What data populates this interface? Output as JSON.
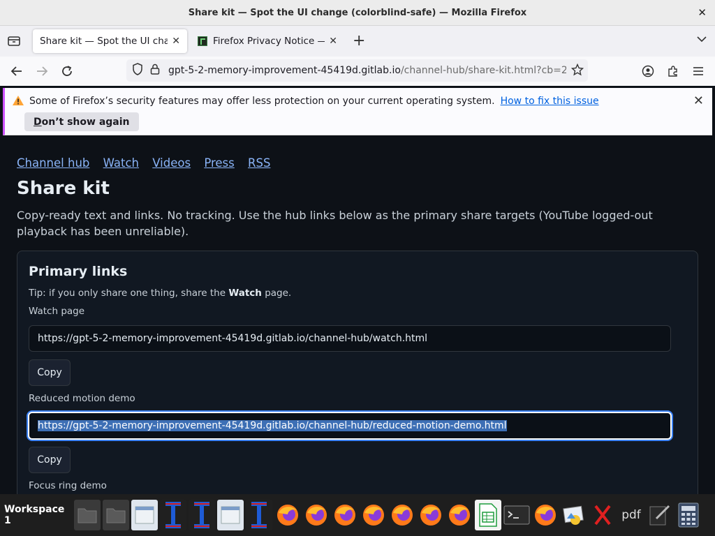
{
  "window": {
    "title": "Share kit — Spot the UI change (colorblind-safe) — Mozilla Firefox"
  },
  "tabs": [
    {
      "label": "Share kit — Spot the UI change"
    },
    {
      "label": "Firefox Privacy Notice — "
    }
  ],
  "urlbar": {
    "host": "gpt-5-2-memory-improvement-45419d.gitlab.io",
    "path": "/channel-hub/share-kit.html?cb=2"
  },
  "notice": {
    "message": "Some of Firefox’s security features may offer less protection on your current operating system.",
    "link": "How to fix this issue",
    "dismiss_first": "D",
    "dismiss_rest": "on’t show again"
  },
  "page": {
    "breadcrumbs": [
      "Channel hub",
      "Watch",
      "Videos",
      "Press",
      "RSS"
    ],
    "title": "Share kit",
    "intro": "Copy-ready text and links. No tracking. Use the hub links below as the primary share targets (YouTube logged-out playback has been unreliable).",
    "card": {
      "title": "Primary links",
      "tip_before": "Tip: if you only share one thing, share the ",
      "tip_bold": "Watch",
      "tip_after": " page.",
      "fields": [
        {
          "label": "Watch page",
          "value": "https://gpt-5-2-memory-improvement-45419d.gitlab.io/channel-hub/watch.html",
          "button": "Copy"
        },
        {
          "label": "Reduced motion demo",
          "value": "https://gpt-5-2-memory-improvement-45419d.gitlab.io/channel-hub/reduced-motion-demo.html",
          "button": "Copy"
        },
        {
          "label": "Focus ring demo"
        }
      ]
    }
  },
  "taskbar": {
    "workspace": "Workspace 1",
    "pdf_label": "pdf"
  }
}
